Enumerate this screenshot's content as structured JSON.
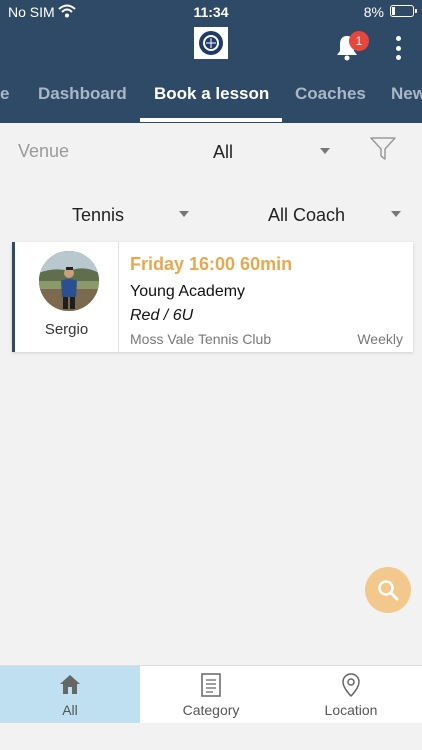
{
  "status_bar": {
    "carrier": "No SIM",
    "time": "11:34",
    "battery": "8%"
  },
  "notifications": {
    "count": "1"
  },
  "tabs": [
    {
      "label": "e"
    },
    {
      "label": "Dashboard"
    },
    {
      "label": "Book a lesson"
    },
    {
      "label": "Coaches"
    },
    {
      "label": "New"
    }
  ],
  "filters": {
    "venue_label": "Venue",
    "venue_value": "All",
    "sport_value": "Tennis",
    "coach_value": "All Coach"
  },
  "lesson": {
    "coach": "Sergio",
    "time": "Friday 16:00 60min",
    "name": "Young Academy",
    "level": "Red / 6U",
    "venue": "Moss Vale Tennis Club",
    "frequency": "Weekly"
  },
  "bottom_nav": [
    {
      "label": "All"
    },
    {
      "label": "Category"
    },
    {
      "label": "Location"
    }
  ],
  "colors": {
    "header": "#2e4a66",
    "accent": "#e9a84f",
    "badge": "#e8453c",
    "nav_active": "#bfe0f0"
  }
}
